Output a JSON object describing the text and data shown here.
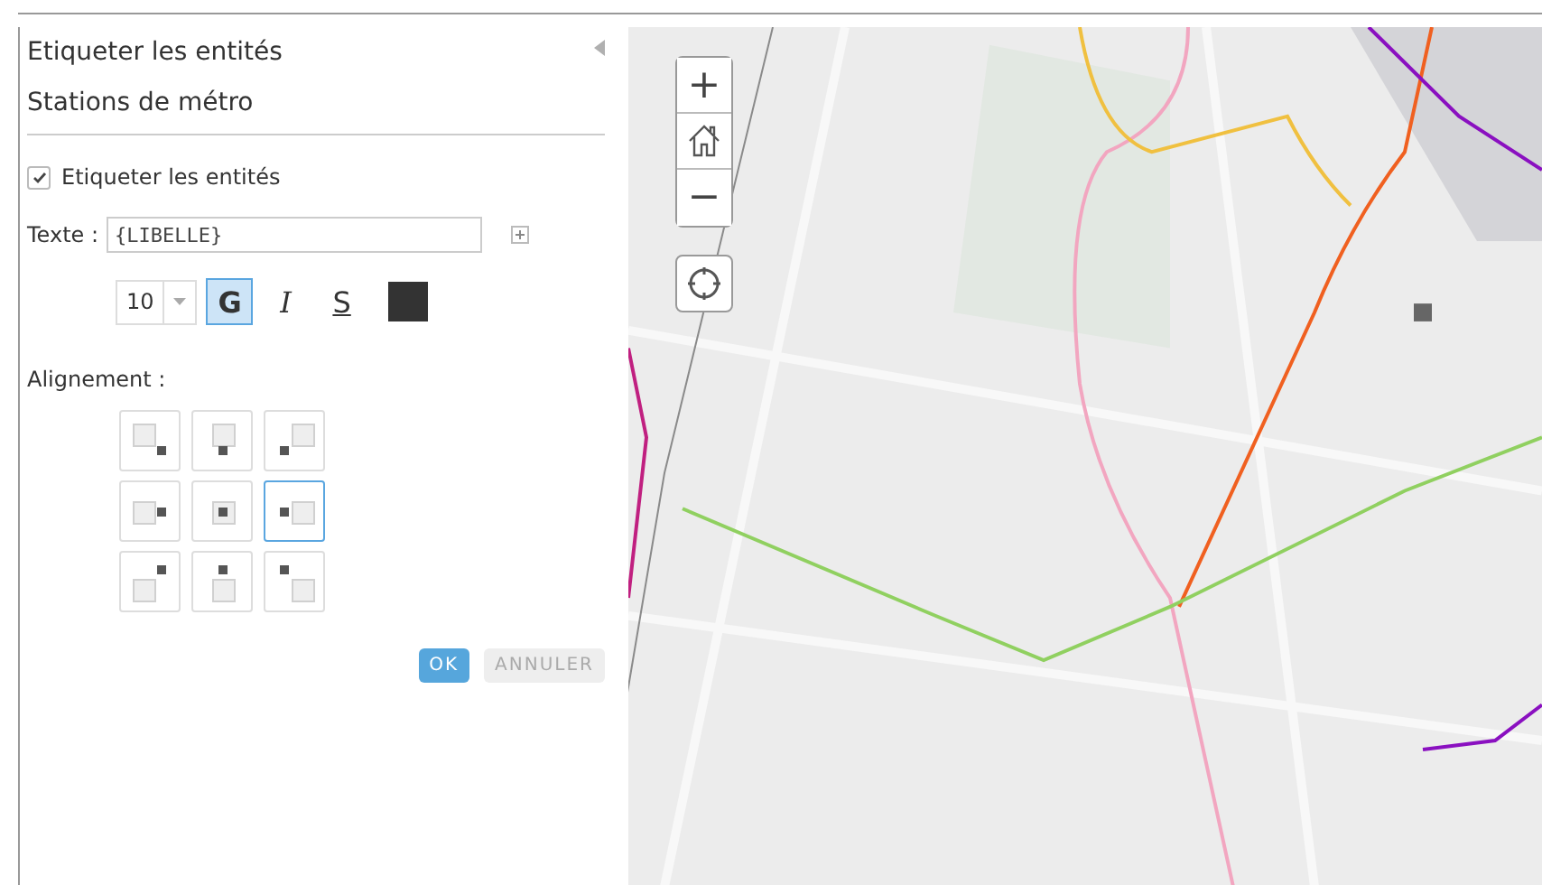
{
  "panel": {
    "title": "Etiqueter les entités",
    "layer": "Stations de métro"
  },
  "label_checkbox": {
    "label": "Etiqueter les entités",
    "checked": true
  },
  "text_field": {
    "label": "Texte :",
    "value": "{LIBELLE}"
  },
  "font_size": {
    "value": "10"
  },
  "style_buttons": [
    {
      "label": "G",
      "kind": "bold",
      "selected": true
    },
    {
      "label": "I",
      "kind": "italic",
      "selected": false
    },
    {
      "label": "S",
      "kind": "underline",
      "selected": false
    }
  ],
  "text_color": {
    "color": "#333333"
  },
  "alignment": {
    "label": "Alignement :",
    "options": [
      {
        "selected": false
      },
      {
        "selected": false
      },
      {
        "selected": false
      },
      {
        "selected": false
      },
      {
        "selected": false
      },
      {
        "selected": true
      },
      {
        "selected": false
      },
      {
        "selected": false
      },
      {
        "selected": false
      }
    ]
  },
  "buttons": [
    {
      "label": "OK",
      "kind": "primary"
    },
    {
      "label": "ANNULER",
      "kind": "secondary"
    }
  ],
  "map": {
    "zoom_controls": [
      "+",
      "−"
    ]
  }
}
